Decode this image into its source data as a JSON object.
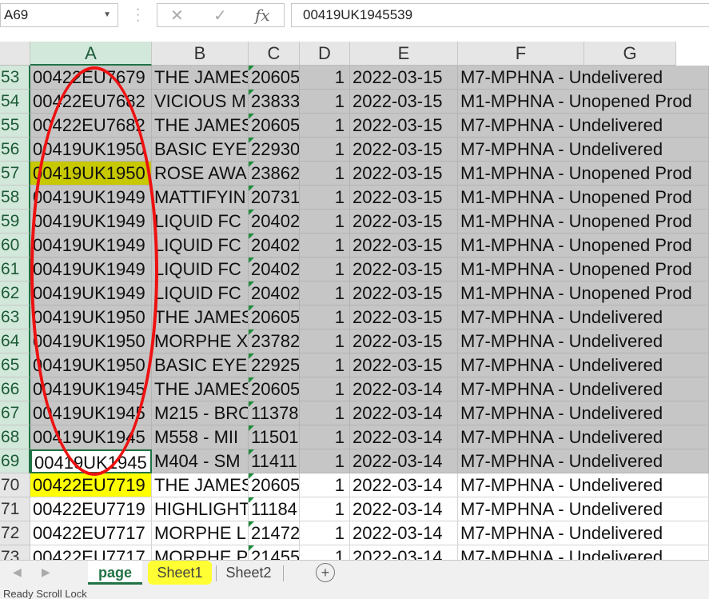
{
  "name_box": "A69",
  "formula_value": "00419UK1945539",
  "columns": [
    "A",
    "B",
    "C",
    "D",
    "E",
    "F",
    "G"
  ],
  "selected_column": "A",
  "rows": [
    {
      "n": "53",
      "a": "00422EU7679",
      "b": "THE JAMES",
      "c": "20605",
      "d": "1",
      "e": "2022-03-15",
      "f": "M7-MPHNA - Undelivered"
    },
    {
      "n": "54",
      "a": "00422EU7682",
      "b": "VICIOUS M",
      "c": "23833",
      "d": "1",
      "e": "2022-03-15",
      "f": "M1-MPHNA - Unopened Prod"
    },
    {
      "n": "55",
      "a": "00422EU7682",
      "b": "THE JAMES",
      "c": "20605",
      "d": "1",
      "e": "2022-03-15",
      "f": "M7-MPHNA - Undelivered"
    },
    {
      "n": "56",
      "a": "00419UK1950",
      "b": "BASIC EYEI",
      "c": "22930",
      "d": "1",
      "e": "2022-03-15",
      "f": "M7-MPHNA - Undelivered"
    },
    {
      "n": "57",
      "a": "00419UK1950",
      "b": "ROSE AWA",
      "c": "23862",
      "d": "1",
      "e": "2022-03-15",
      "f": "M1-MPHNA - Unopened Prod"
    },
    {
      "n": "58",
      "a": "00419UK1949",
      "b": "MATTIFYIN",
      "c": "20731",
      "d": "1",
      "e": "2022-03-15",
      "f": "M1-MPHNA - Unopened Prod"
    },
    {
      "n": "59",
      "a": "00419UK1949",
      "b": "LIQUID FC",
      "c": "20402",
      "d": "1",
      "e": "2022-03-15",
      "f": "M1-MPHNA - Unopened Prod"
    },
    {
      "n": "60",
      "a": "00419UK1949",
      "b": "LIQUID FC",
      "c": "20402",
      "d": "1",
      "e": "2022-03-15",
      "f": "M1-MPHNA - Unopened Prod"
    },
    {
      "n": "61",
      "a": "00419UK1949",
      "b": "LIQUID FC",
      "c": "20402",
      "d": "1",
      "e": "2022-03-15",
      "f": "M1-MPHNA - Unopened Prod"
    },
    {
      "n": "62",
      "a": "00419UK1949",
      "b": "LIQUID FC",
      "c": "20402",
      "d": "1",
      "e": "2022-03-15",
      "f": "M1-MPHNA - Unopened Prod"
    },
    {
      "n": "63",
      "a": "00419UK1950",
      "b": "THE JAMES",
      "c": "20605",
      "d": "1",
      "e": "2022-03-15",
      "f": "M7-MPHNA - Undelivered"
    },
    {
      "n": "64",
      "a": "00419UK1950",
      "b": "MORPHE X",
      "c": "23782",
      "d": "1",
      "e": "2022-03-15",
      "f": "M7-MPHNA - Undelivered"
    },
    {
      "n": "65",
      "a": "00419UK1950",
      "b": "BASIC EYEI",
      "c": "22925",
      "d": "1",
      "e": "2022-03-15",
      "f": "M7-MPHNA - Undelivered"
    },
    {
      "n": "66",
      "a": "00419UK1945",
      "b": "THE JAMES",
      "c": "20605",
      "d": "1",
      "e": "2022-03-14",
      "f": "M7-MPHNA - Undelivered"
    },
    {
      "n": "67",
      "a": "00419UK1945",
      "b": "M215 - BRO",
      "c": "11378",
      "d": "1",
      "e": "2022-03-14",
      "f": "M7-MPHNA - Undelivered"
    },
    {
      "n": "68",
      "a": "00419UK1945",
      "b": "M558 - MII",
      "c": "11501",
      "d": "1",
      "e": "2022-03-14",
      "f": "M7-MPHNA - Undelivered"
    },
    {
      "n": "69",
      "a": "00419UK1945",
      "b": "M404 - SM",
      "c": "11411",
      "d": "1",
      "e": "2022-03-14",
      "f": "M7-MPHNA - Undelivered"
    },
    {
      "n": "70",
      "a": "00422EU7719",
      "b": "THE JAMES",
      "c": "20605",
      "d": "1",
      "e": "2022-03-14",
      "f": "M7-MPHNA - Undelivered"
    },
    {
      "n": "71",
      "a": "00422EU7719",
      "b": "HIGHLIGHT",
      "c": "11184",
      "d": "1",
      "e": "2022-03-14",
      "f": "M7-MPHNA - Undelivered"
    },
    {
      "n": "72",
      "a": "00422EU7717",
      "b": "MORPHE L",
      "c": "21472",
      "d": "1",
      "e": "2022-03-14",
      "f": "M7-MPHNA - Undelivered"
    },
    {
      "n": "73",
      "a": "00422EU7717",
      "b": "MORPHE P",
      "c": "21455",
      "d": "1",
      "e": "2022-03-14",
      "f": "M7-MPHNA - Undelivered"
    }
  ],
  "tabs": [
    "page",
    "Sheet1",
    "Sheet2"
  ],
  "active_tab": "page",
  "status_text": "Ready   Scroll Lock",
  "colors": {
    "accent": "#217346",
    "highlight_olive": "#c8c800",
    "highlight_yellow": "#ffff00",
    "annotation_red": "#e11111"
  }
}
